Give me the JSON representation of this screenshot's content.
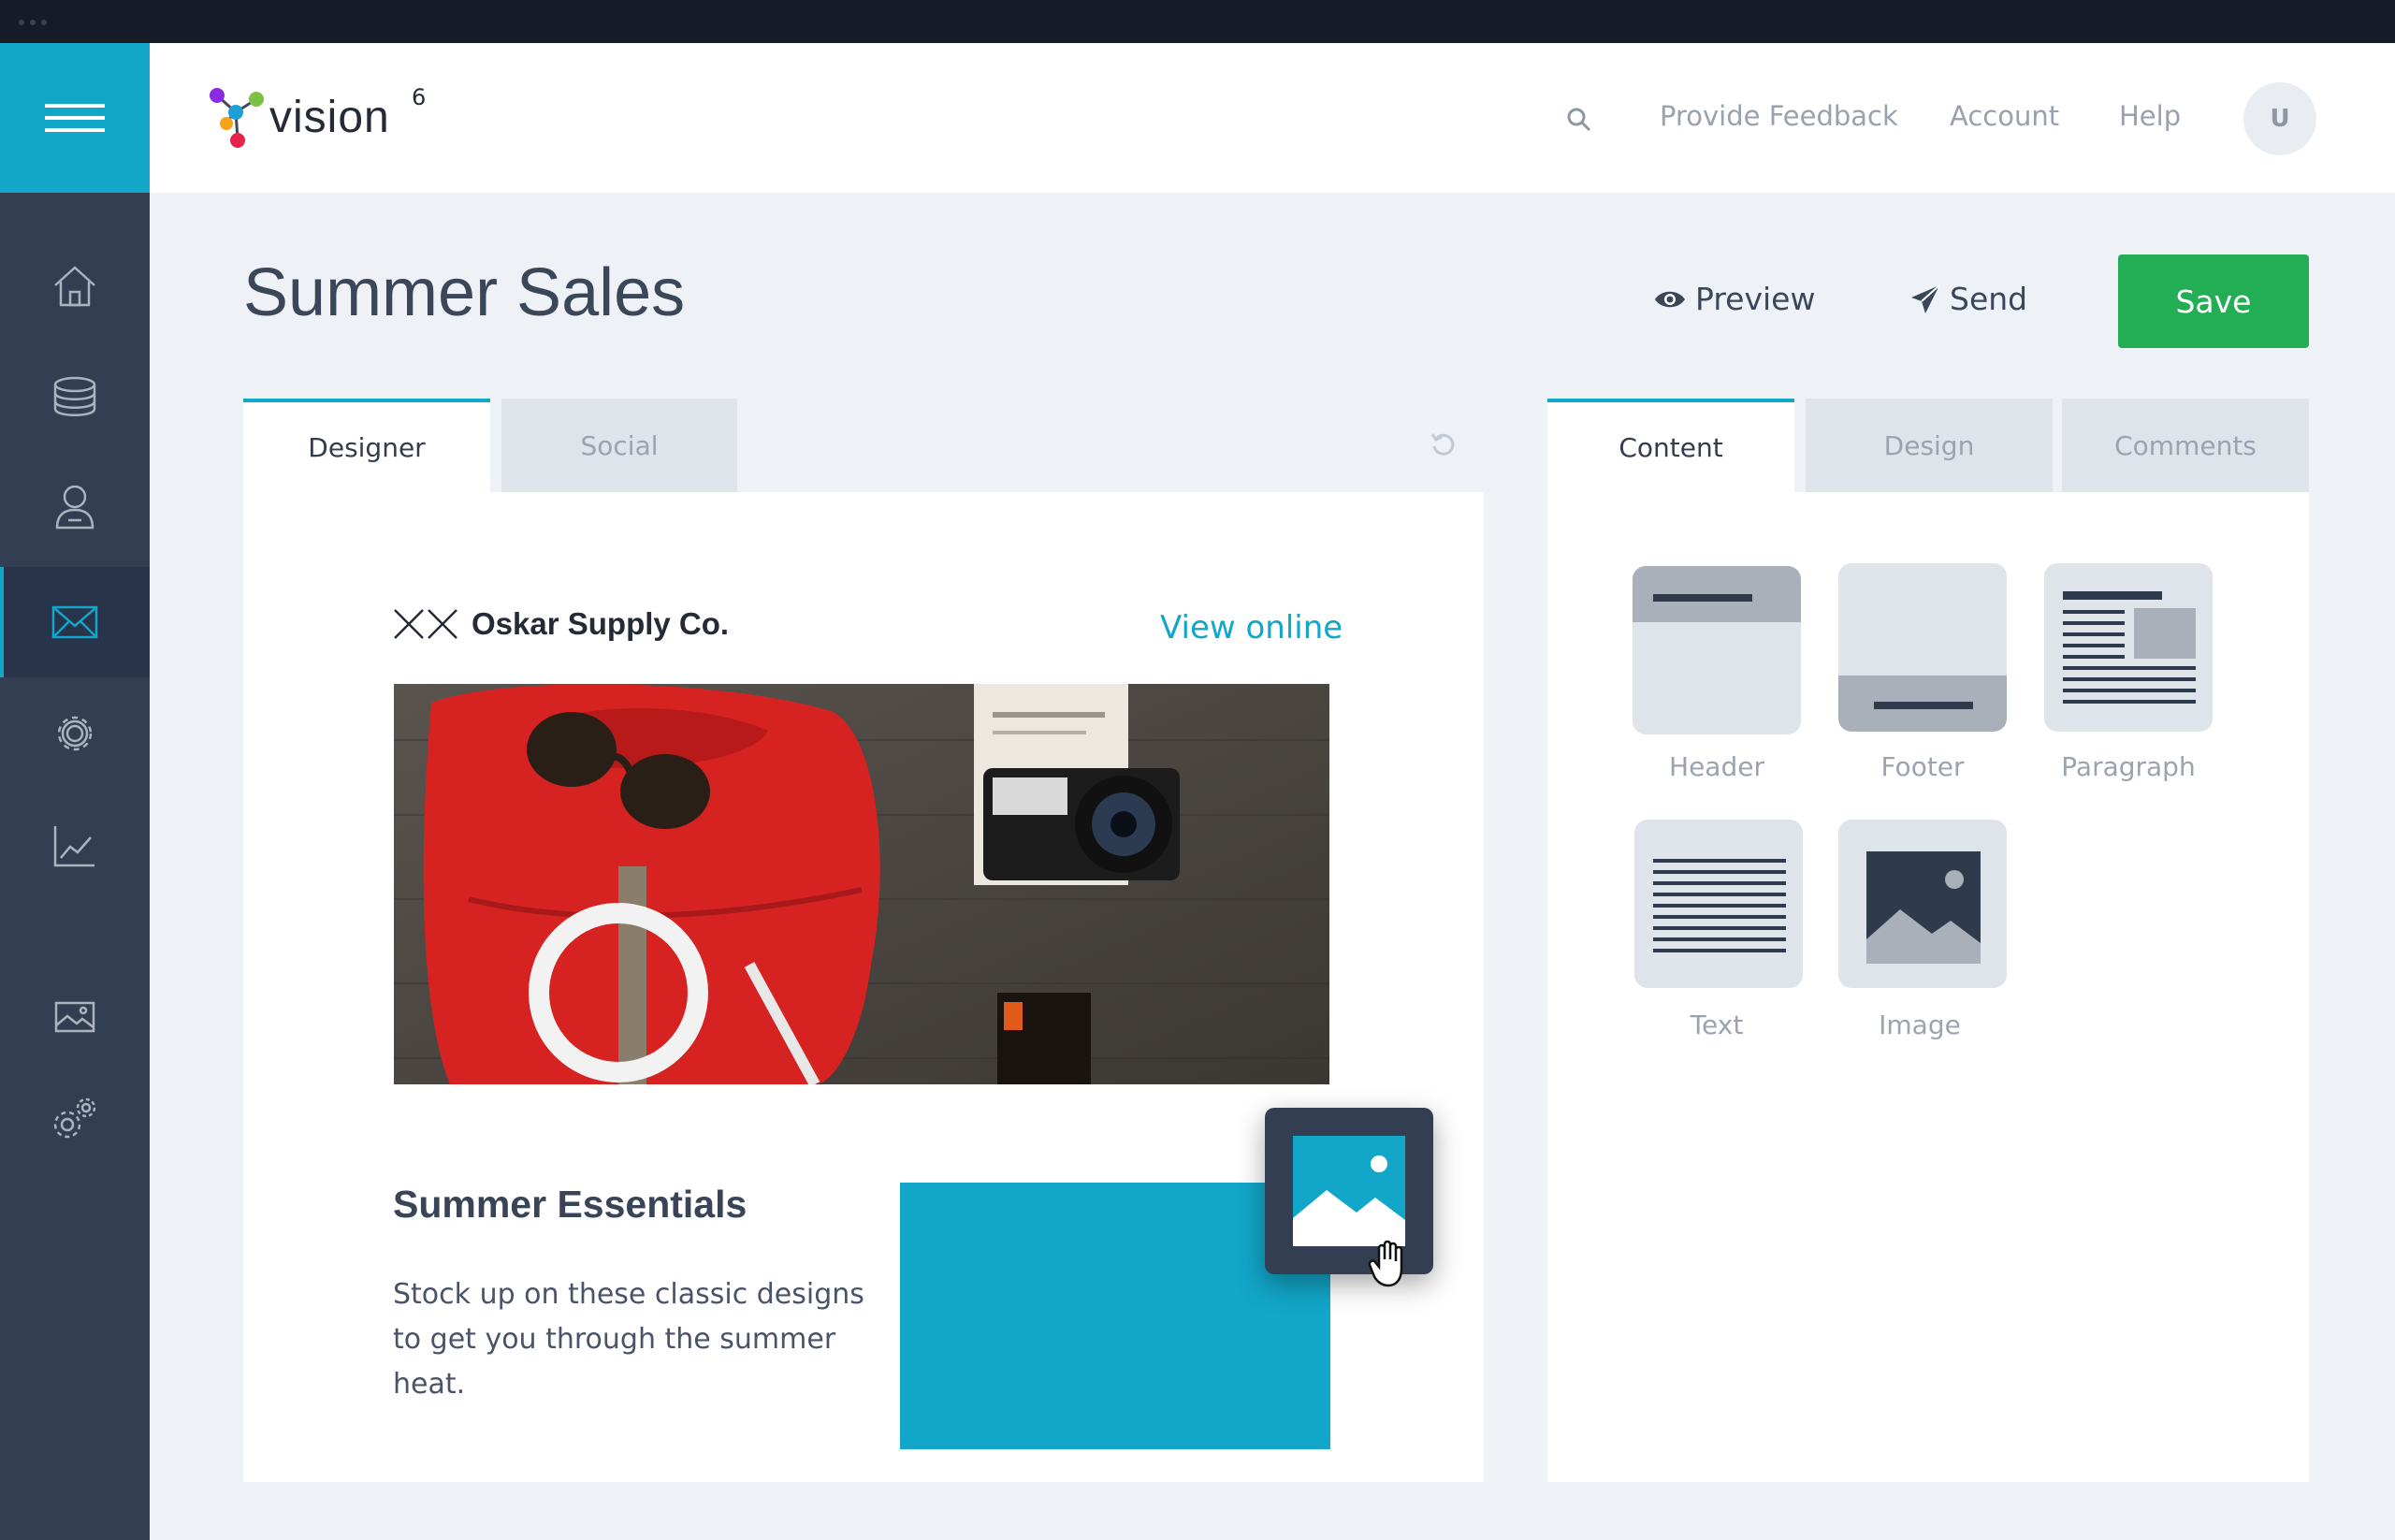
{
  "brand": {
    "name": "vision",
    "superscript": "6"
  },
  "topbar": {
    "links": [
      "Provide Feedback",
      "Account",
      "Help"
    ],
    "avatar_initial": "U"
  },
  "page": {
    "title": "Summer Sales"
  },
  "actions": {
    "preview": "Preview",
    "send": "Send",
    "save": "Save"
  },
  "editor_tabs": [
    {
      "label": "Designer",
      "active": true
    },
    {
      "label": "Social",
      "active": false
    }
  ],
  "side_tabs": [
    {
      "label": "Content",
      "active": true
    },
    {
      "label": "Design",
      "active": false
    },
    {
      "label": "Comments",
      "active": false
    }
  ],
  "email": {
    "brand_name": "Oskar Supply Co.",
    "view_online": "View online",
    "section_title": "Summer Essentials",
    "section_body": "Stock up on these classic designs to get you through the summer heat."
  },
  "blocks": [
    {
      "label": "Header",
      "icon": "header-block-icon"
    },
    {
      "label": "Footer",
      "icon": "footer-block-icon"
    },
    {
      "label": "Paragraph",
      "icon": "paragraph-block-icon"
    },
    {
      "label": "Text",
      "icon": "text-block-icon"
    },
    {
      "label": "Image",
      "icon": "image-block-icon"
    }
  ],
  "sidebar_icons": [
    "home-icon",
    "database-icon",
    "contacts-icon",
    "email-icon",
    "settings-icon",
    "reports-icon",
    "media-icon",
    "integrations-icon"
  ],
  "colors": {
    "accent": "#12a6c9",
    "rail": "#323e51",
    "save": "#23ad54"
  }
}
